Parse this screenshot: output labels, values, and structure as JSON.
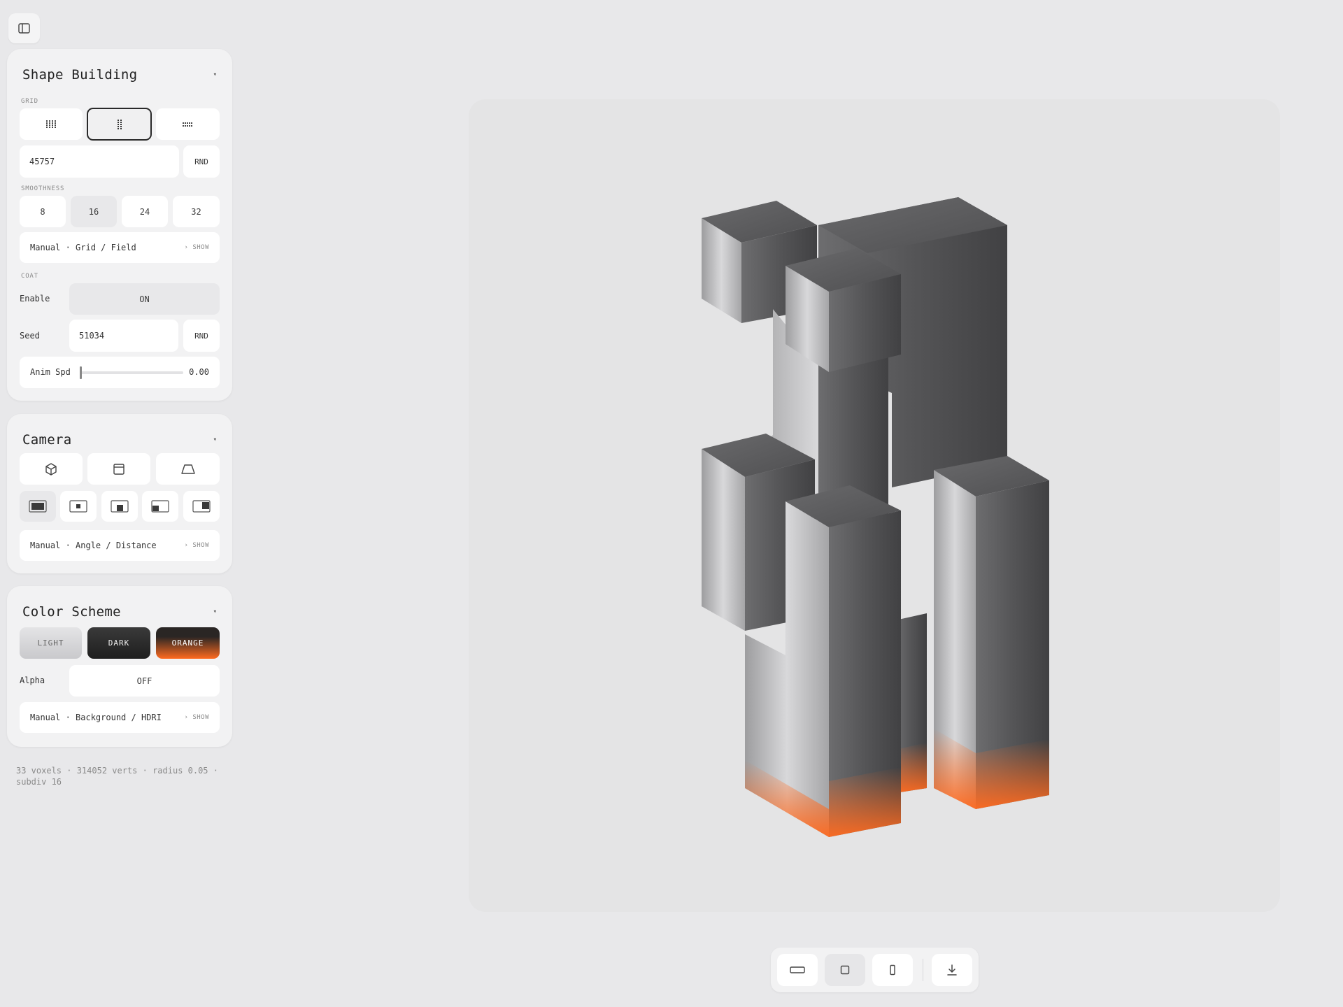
{
  "icons": {
    "sidebar_toggle": "sidebar-panel-icon",
    "grid_options": [
      "grid-square-icon",
      "grid-vertical-icon",
      "grid-horizontal-icon"
    ],
    "camera_views": [
      "cube-icon",
      "front-view-icon",
      "perspective-icon"
    ],
    "framing": [
      "frame-full-icon",
      "frame-center-icon",
      "frame-bottom-icon",
      "frame-bottom-left-icon",
      "frame-right-icon"
    ],
    "bottom_bar": [
      "landscape-aspect-icon",
      "square-aspect-icon",
      "portrait-aspect-icon",
      "download-icon"
    ]
  },
  "shape_building": {
    "title": "Shape Building",
    "grid_label": "GRID",
    "selected_grid": 1,
    "seed_value": "45757",
    "rnd_label": "RND",
    "smoothness_label": "SMOOTHNESS",
    "smoothness_options": [
      "8",
      "16",
      "24",
      "32"
    ],
    "smoothness_selected": "16",
    "manual_label": "Manual · Grid / Field",
    "show_label": "› SHOW",
    "coat_label": "COAT",
    "enable_label": "Enable",
    "enable_value": "ON",
    "seed_label": "Seed",
    "coat_seed": "51034",
    "coat_rnd_label": "RND",
    "anim_label": "Anim Spd",
    "anim_value": "0.00",
    "anim_fraction": 0
  },
  "camera": {
    "title": "Camera",
    "selected_view": 0,
    "selected_frame": 0,
    "manual_label": "Manual · Angle / Distance",
    "show_label": "› SHOW"
  },
  "color_scheme": {
    "title": "Color Scheme",
    "options": [
      "LIGHT",
      "DARK",
      "ORANGE"
    ],
    "selected": "ORANGE",
    "alpha_label": "Alpha",
    "alpha_value": "OFF",
    "manual_label": "Manual · Background / HDRI",
    "show_label": "› SHOW"
  },
  "stats": "33 voxels · 314052 verts · radius 0.05 · subdiv 16",
  "colors": {
    "accent_orange": "#ff6a1f",
    "dark": "#2a2a2a",
    "panel": "#f2f2f3",
    "background": "#e8e8ea"
  },
  "bottom_bar": {
    "selected": 1
  }
}
